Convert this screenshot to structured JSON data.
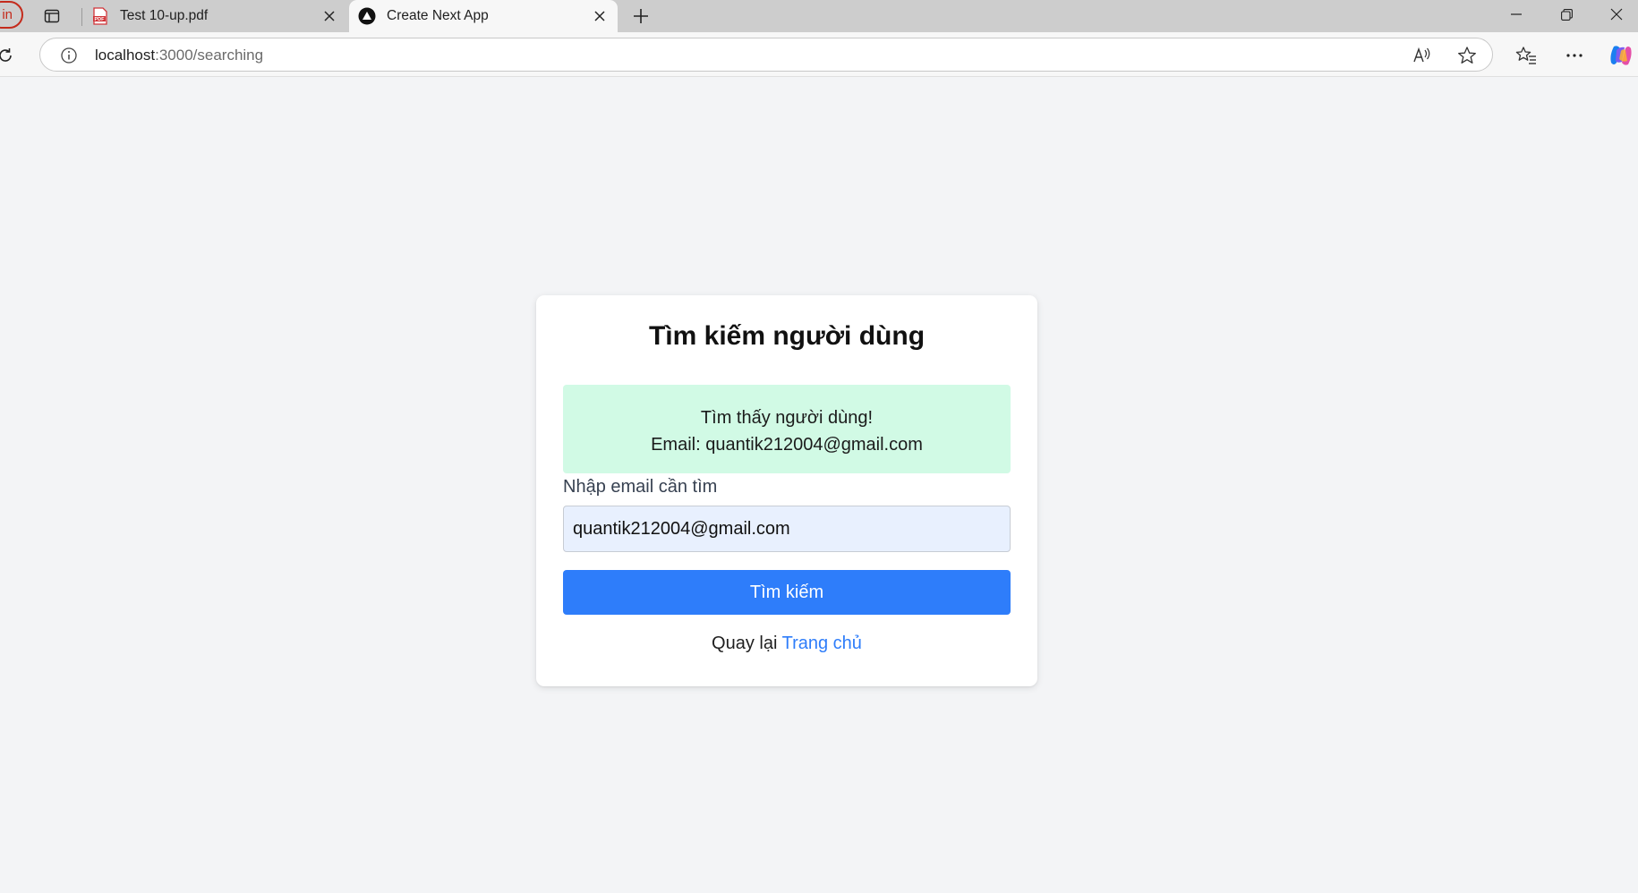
{
  "browser": {
    "profile_label": "in",
    "tabs": [
      {
        "title": "Test 10-up.pdf",
        "favicon": "pdf-icon",
        "active": false
      },
      {
        "title": "Create Next App",
        "favicon": "nextjs-icon",
        "active": true
      }
    ],
    "address": {
      "host": "localhost",
      "path": ":3000/searching"
    },
    "icons": {
      "workspaces": "tab-actions-icon",
      "new_tab": "plus-icon",
      "reload": "reload-icon",
      "site_info": "info-icon",
      "read_aloud": "read-aloud-icon",
      "favorite": "star-icon",
      "favorites": "favorites-icon",
      "more": "more-icon",
      "copilot": "copilot-icon",
      "minimize": "minimize-icon",
      "maximize": "restore-icon",
      "close": "close-icon"
    }
  },
  "page": {
    "title": "Tìm kiếm người dùng",
    "result": {
      "message": "Tìm thấy người dùng!",
      "email_line": "Email: quantik212004@gmail.com"
    },
    "form": {
      "label": "Nhập email cần tìm",
      "value": "quantik212004@gmail.com",
      "button_label": "Tìm kiếm"
    },
    "footer": {
      "prefix": "Quay lại",
      "link_label": "Trang chủ"
    }
  },
  "colors": {
    "page_bg": "#f3f4f6",
    "success_bg": "#d1fae5",
    "primary": "#2e7dfa",
    "input_bg": "#e8f0fe"
  }
}
